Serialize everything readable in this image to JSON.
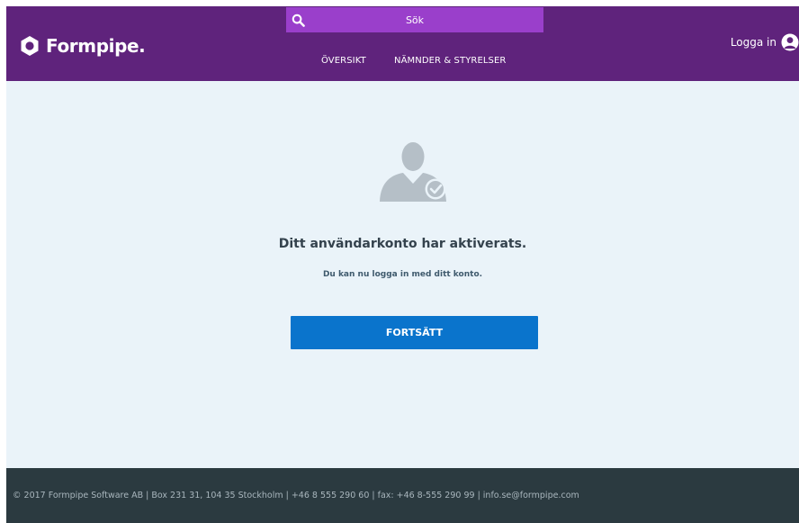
{
  "header": {
    "logo_text": "Formpipe.",
    "search_placeholder": "Sök",
    "nav": [
      {
        "label": "ÖVERSIKT"
      },
      {
        "label": "NÄMNDER & STYRELSER"
      }
    ],
    "login_label": "Logga in"
  },
  "main": {
    "title": "Ditt användarkonto har aktiverats.",
    "subtitle": "Du kan nu logga in med ditt konto.",
    "continue_label": "FORTSÄTT"
  },
  "footer": {
    "text": "© 2017 Formpipe Software AB | Box 231 31, 104 35 Stockholm | +46 8 555 290 60 | fax: +46 8-555 290 99 | info.se@formpipe.com"
  },
  "colors": {
    "header_bg": "#5f237c",
    "search_bg": "#9a3fcb",
    "content_bg": "#eaf3f9",
    "button_bg": "#0a74cc",
    "footer_bg": "#2b3a40"
  }
}
